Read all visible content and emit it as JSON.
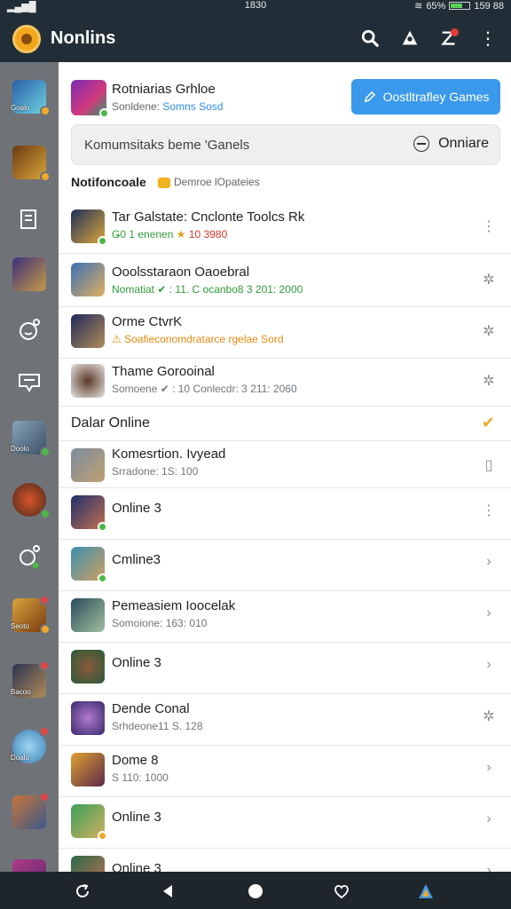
{
  "status_bar": {
    "time": "1830",
    "battery": "65%",
    "right_time": "159 88",
    "battery_level": 0.65
  },
  "app": {
    "title": "Nonlins"
  },
  "hero": {
    "title": "Rotniarias Grhloe",
    "sub_prefix": "Sonldene:",
    "sub_highlight": "Somns Sosd",
    "button_label": "Oostltrafley Games"
  },
  "search": {
    "text": "Komumsitaks beme 'Ganels",
    "action_label": "Onniare"
  },
  "notifications": {
    "heading": "Notifoncoale",
    "note": "Demroe lOpateies",
    "rows": [
      {
        "title": "Tar Galstate: Cnclonte Toolcs Rk",
        "sub_a": "Ǥ0 1 enenen",
        "sub_b": "10 3980",
        "action": "more"
      },
      {
        "title": "Ooolsstaraon Oaoebral",
        "sub": "Nomatiat ✔ : 11. C ocanbo8 3 201: 2000",
        "action": "gear"
      },
      {
        "title": "Orme CtvrK",
        "sub": "Soafieconomdratarce rgelae Sord",
        "action": "gear"
      },
      {
        "title": "Thame Gorooinal",
        "sub": "Somoene ✔ : 10 Conlecdr: 3 211: 2060",
        "action": "gear"
      }
    ]
  },
  "online": {
    "heading": "Dalar Online",
    "rows": [
      {
        "title": "Komesrtion. Ivyead",
        "sub": "Srradone: 1S: 100",
        "action": "copy"
      },
      {
        "title": "Online 3",
        "sub": "",
        "action": "more"
      },
      {
        "title": "Cmline3",
        "sub": "",
        "action": "chevron"
      },
      {
        "title": "Pemeasiem Ioocelak",
        "sub": "Somoione: 163: 010",
        "action": "chevron"
      },
      {
        "title": "Online 3",
        "sub": "",
        "action": "chevron"
      },
      {
        "title": "Dende Conal",
        "sub": "Srhdeone11 S. 128",
        "action": "gear"
      },
      {
        "title": "Dome 8",
        "sub": "S 110: 1000",
        "action": "chevron"
      },
      {
        "title": "Online 3",
        "sub": "",
        "action": "chevron"
      },
      {
        "title": "Online 3",
        "sub": "",
        "action": "chevron"
      }
    ]
  },
  "sidebar": {
    "tags": [
      "Goalo",
      "Doolo",
      "Seoto",
      "Bacoo",
      "Doalo"
    ]
  },
  "colors": {
    "appbar": "#222e37",
    "sidebar": "#6f7378",
    "accent": "#3a99ea",
    "badge": "#f0a92b"
  }
}
